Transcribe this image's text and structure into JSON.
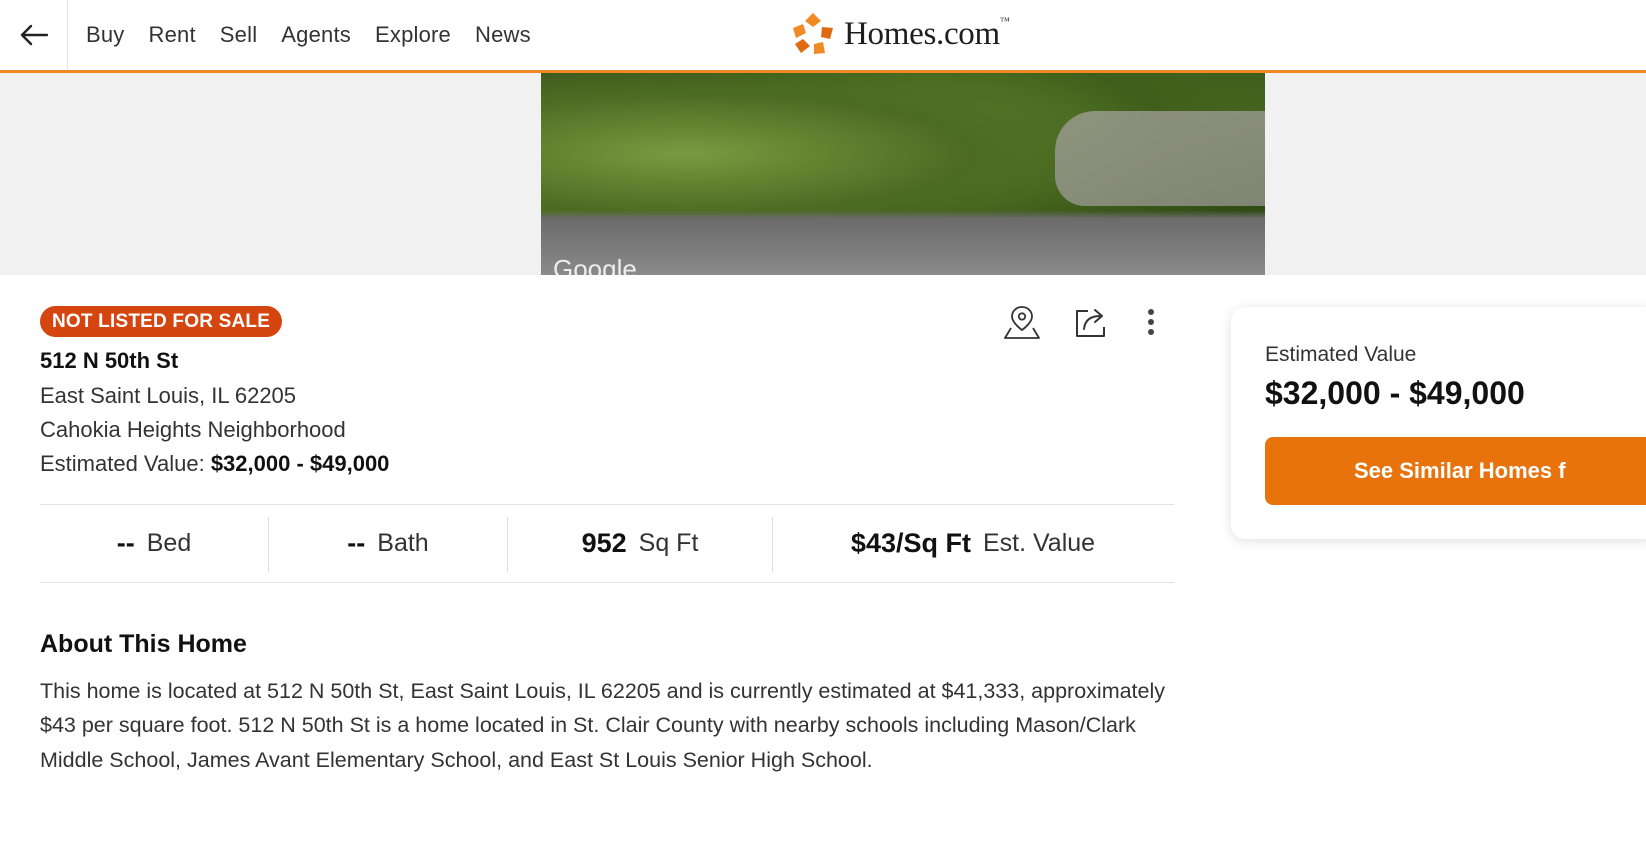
{
  "header": {
    "nav": [
      "Buy",
      "Rent",
      "Sell",
      "Agents",
      "Explore",
      "News"
    ],
    "logo_text": "Homes.com",
    "logo_mark": "™",
    "accent_color": "#f08a24"
  },
  "hero": {
    "watermark": "Google"
  },
  "listing": {
    "status_badge": "NOT LISTED FOR SALE",
    "street": "512 N 50th St",
    "city_line": "East Saint Louis, IL 62205",
    "neighborhood": "Cahokia Heights Neighborhood",
    "est_label": "Estimated Value:",
    "est_value": "$32,000 - $49,000",
    "badge_color": "#d4450f"
  },
  "stats": {
    "bed_value": "--",
    "bed_label": "Bed",
    "bath_value": "--",
    "bath_label": "Bath",
    "sqft_value": "952",
    "sqft_label": "Sq Ft",
    "ppsf_value": "$43/Sq Ft",
    "ppsf_label": "Est. Value"
  },
  "about": {
    "title": "About This Home",
    "text": "This home is located at 512 N 50th St, East Saint Louis, IL 62205 and is currently estimated at $41,333, approximately $43 per square foot. 512 N 50th St is a home located in St. Clair County with nearby schools including Mason/Clark Middle School, James Avant Elementary School, and East St Louis Senior High School."
  },
  "card": {
    "label": "Estimated Value",
    "value": "$32,000 - $49,000",
    "button": "See Similar Homes f",
    "button_color": "#e8720c"
  },
  "icons": [
    "back-arrow-icon",
    "homes-logo-icon",
    "map-pin-icon",
    "share-icon",
    "more-vertical-icon"
  ]
}
